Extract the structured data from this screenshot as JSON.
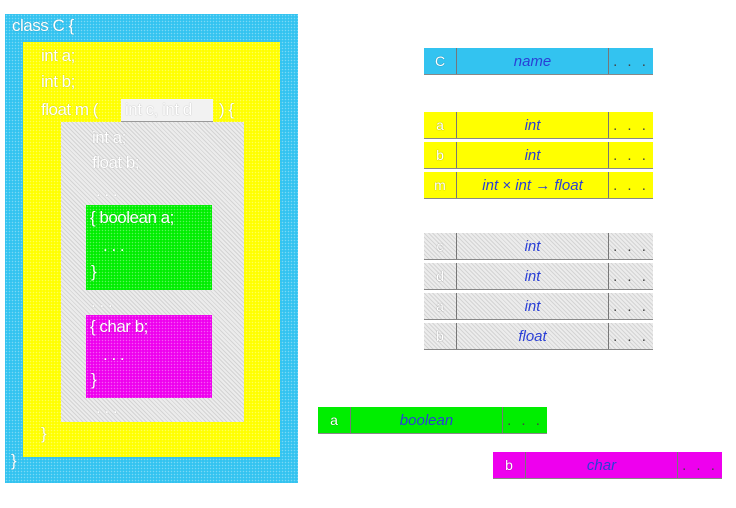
{
  "code": {
    "class_header": "class C {",
    "field_a": "int a;",
    "field_b": "int b;",
    "method_head": "float m (",
    "method_params": "int c, int d",
    "method_open": ") {",
    "local_a": "int a;",
    "local_b": "float b;",
    "dots_1": ". . .",
    "block1_open": "{ boolean a;",
    "block1_dots": ". . .",
    "block1_close": "}",
    "dots_2": ". . .",
    "block2_open": "{ char b;",
    "block2_dots": ". . .",
    "block2_close": "}",
    "dots_3": ". . .",
    "method_close": "}",
    "class_close": "}"
  },
  "tables": {
    "class_table": [
      {
        "name": "C",
        "type": "name",
        "more": ". . ."
      }
    ],
    "member_table": [
      {
        "name": "a",
        "type": "int",
        "more": ". . ."
      },
      {
        "name": "b",
        "type": "int",
        "more": ". . ."
      },
      {
        "name": "m",
        "type": "int × int → float",
        "more": ". . ."
      }
    ],
    "method_table": [
      {
        "name": "c",
        "type": "int",
        "more": ". . ."
      },
      {
        "name": "d",
        "type": "int",
        "more": ". . ."
      },
      {
        "name": "a",
        "type": "int",
        "more": ". . ."
      },
      {
        "name": "b",
        "type": "float",
        "more": ". . ."
      }
    ],
    "block1_table": [
      {
        "name": "a",
        "type": "boolean",
        "more": ". . ."
      }
    ],
    "block2_table": [
      {
        "name": "b",
        "type": "char",
        "more": ". . ."
      }
    ]
  },
  "colors": {
    "class_scope": "#33c3f0",
    "member_scope": "#ffff00",
    "method_scope": "#e0e0e0",
    "block1_scope": "#00ee00",
    "block2_scope": "#ee00ee",
    "type_text": "#2a3fd6"
  }
}
